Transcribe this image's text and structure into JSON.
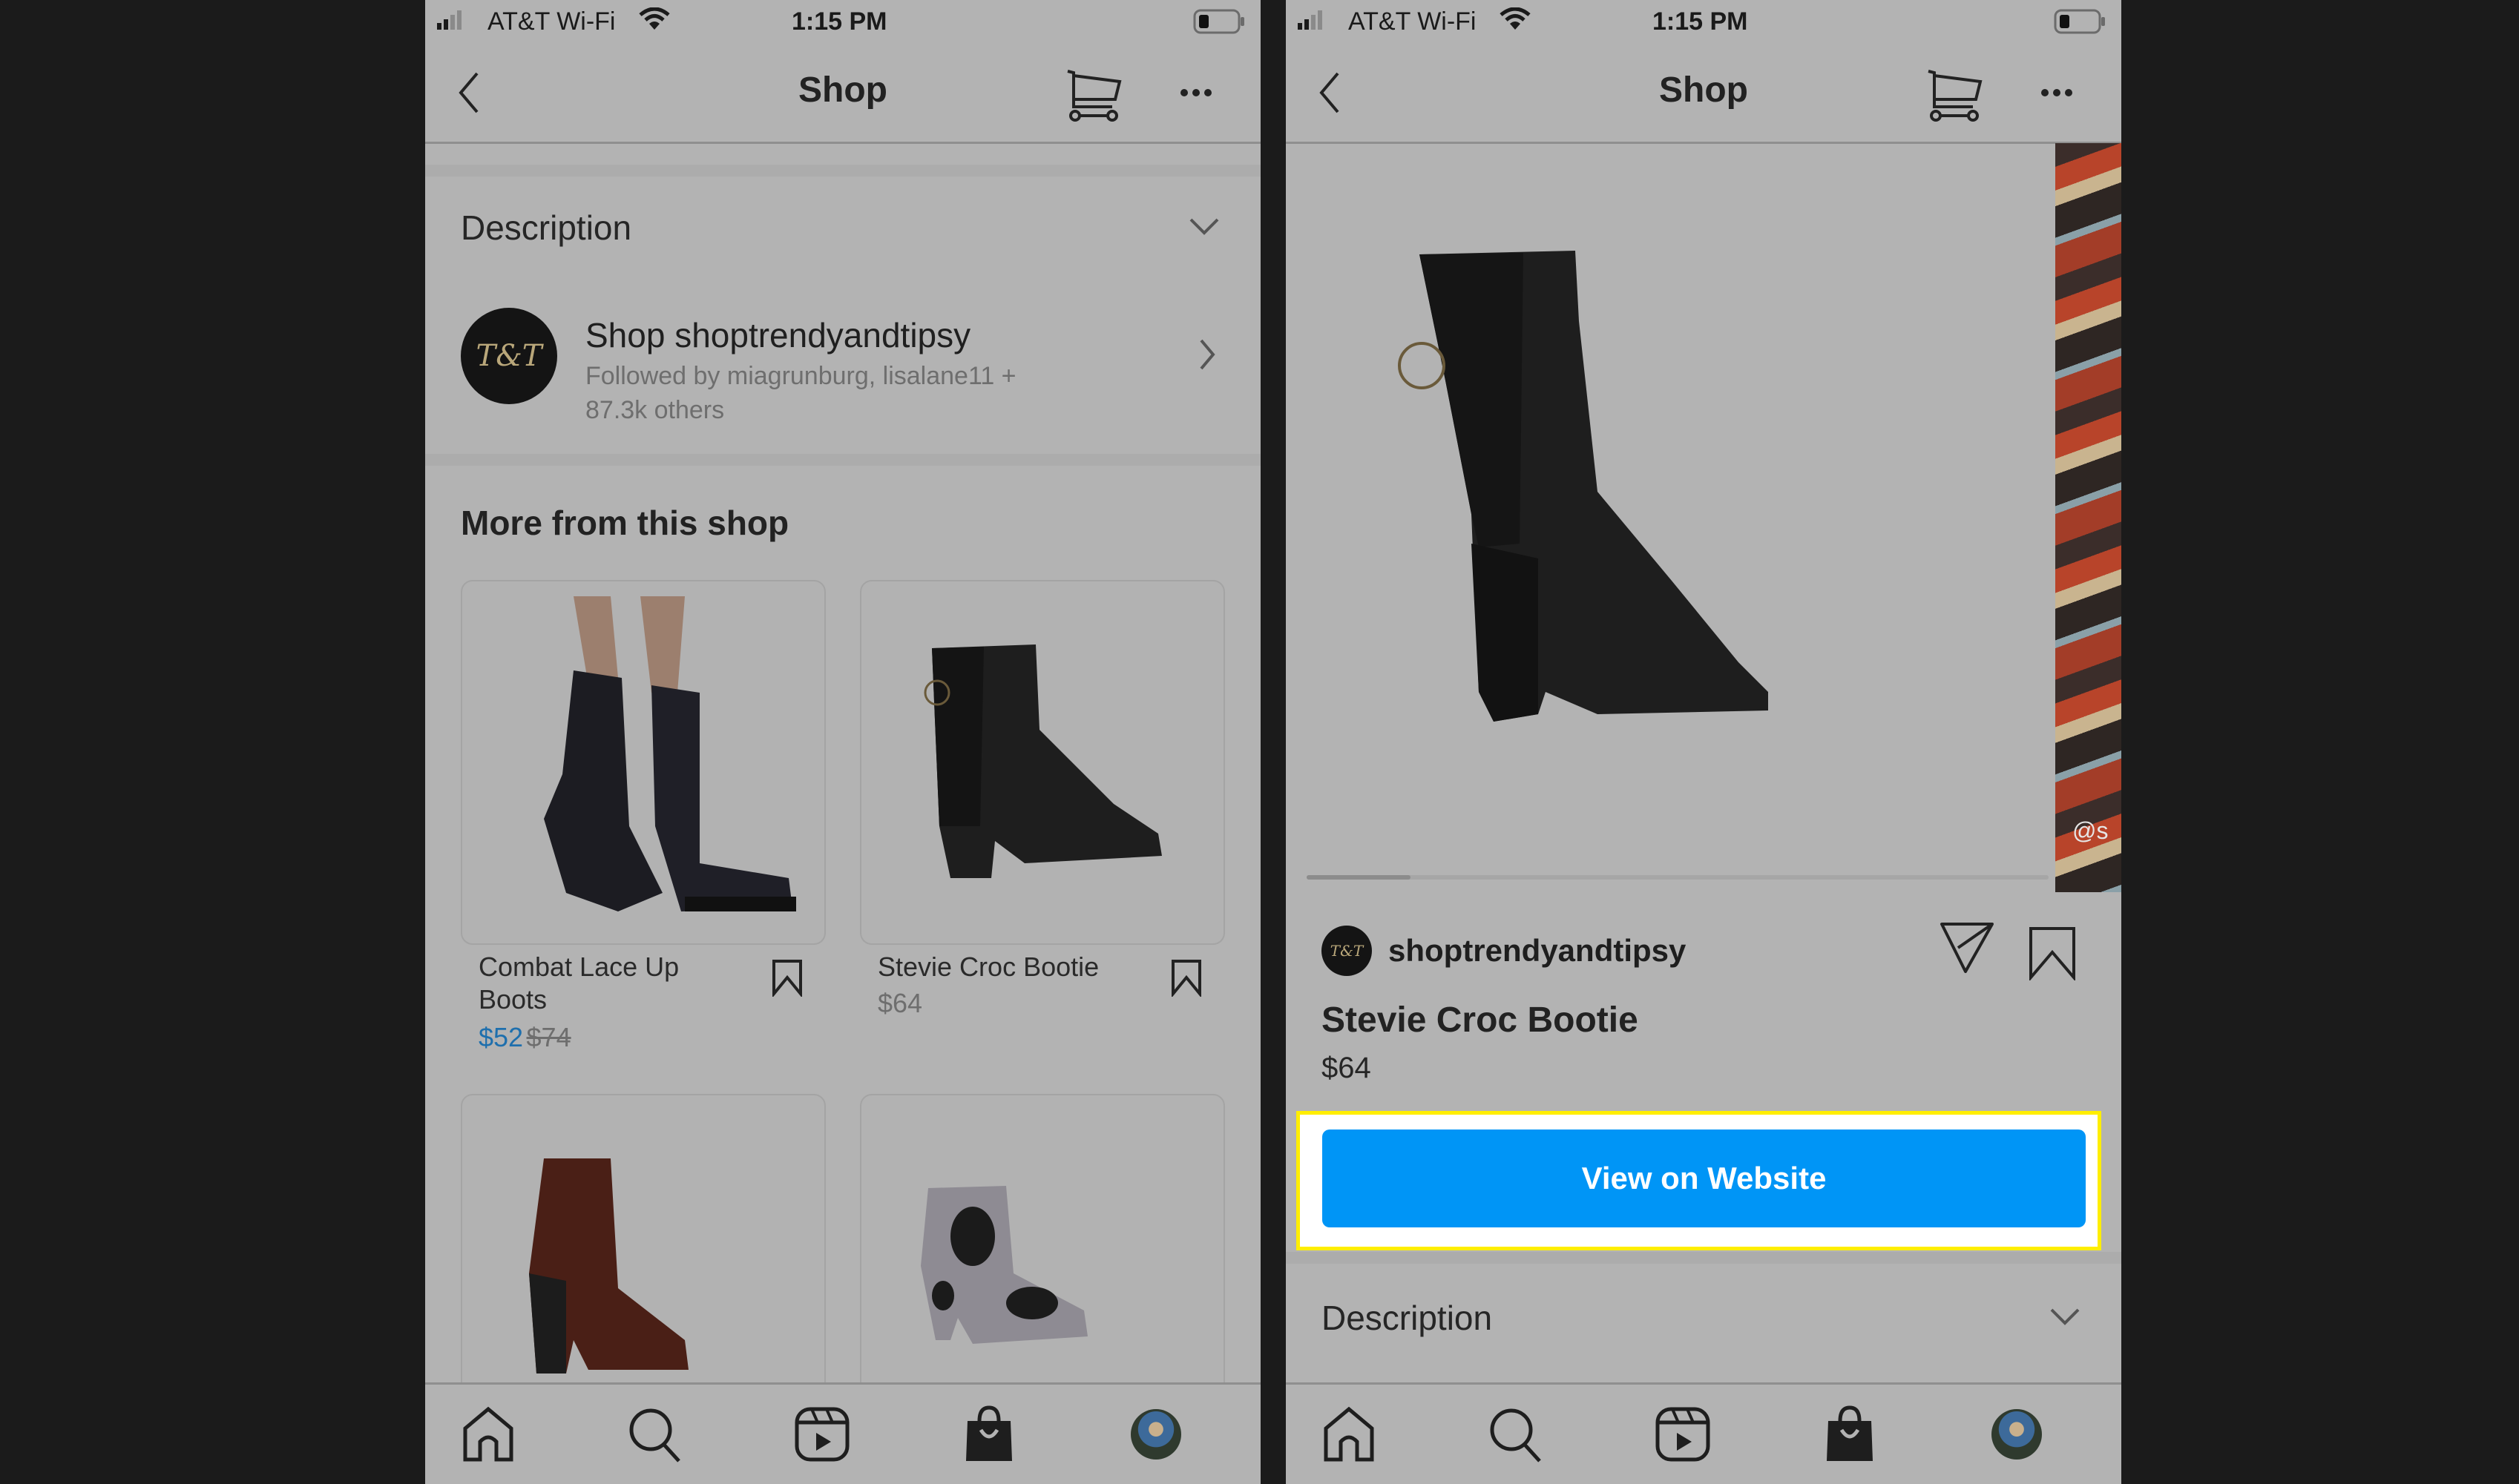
{
  "status_bar": {
    "carrier": "AT&T Wi-Fi",
    "time": "1:15 PM"
  },
  "header": {
    "title": "Shop",
    "back_icon": "chevron-left-icon",
    "cart_icon": "cart-icon",
    "more_icon": "ellipsis-icon"
  },
  "left_screen": {
    "description_label": "Description",
    "shop": {
      "name": "Shop shoptrendyandtipsy",
      "followed_by": "Followed by miagrunburg, lisalane11 +",
      "followed_by_2": "87.3k others",
      "logo_text": "T&T"
    },
    "more_heading": "More from this shop",
    "products": [
      {
        "name_line1": "Combat Lace Up",
        "name_line2": "Boots",
        "sale_price": "$52",
        "original_price": "$74"
      },
      {
        "name_line1": "Stevie Croc Bootie",
        "name_line2": "",
        "price": "$64"
      },
      {
        "name_line1": "",
        "price": ""
      },
      {
        "name_line1": "",
        "price": ""
      }
    ]
  },
  "right_screen": {
    "carousel_progress": 0.14,
    "watermark": "@s",
    "username": "shoptrendyandtipsy",
    "product_title": "Stevie Croc Bootie",
    "product_price": "$64",
    "cta_label": "View on Website",
    "description_label": "Description"
  },
  "tab_bar": [
    "home-icon",
    "search-icon",
    "reels-icon",
    "shop-bag-icon",
    "profile-avatar"
  ],
  "colors": {
    "cta_blue": "#0095f6",
    "highlight_yellow": "#ffee00",
    "sale_blue": "#1e6fad",
    "dim_background": "#b3b3b3",
    "outer_background": "#1b1b1b"
  }
}
